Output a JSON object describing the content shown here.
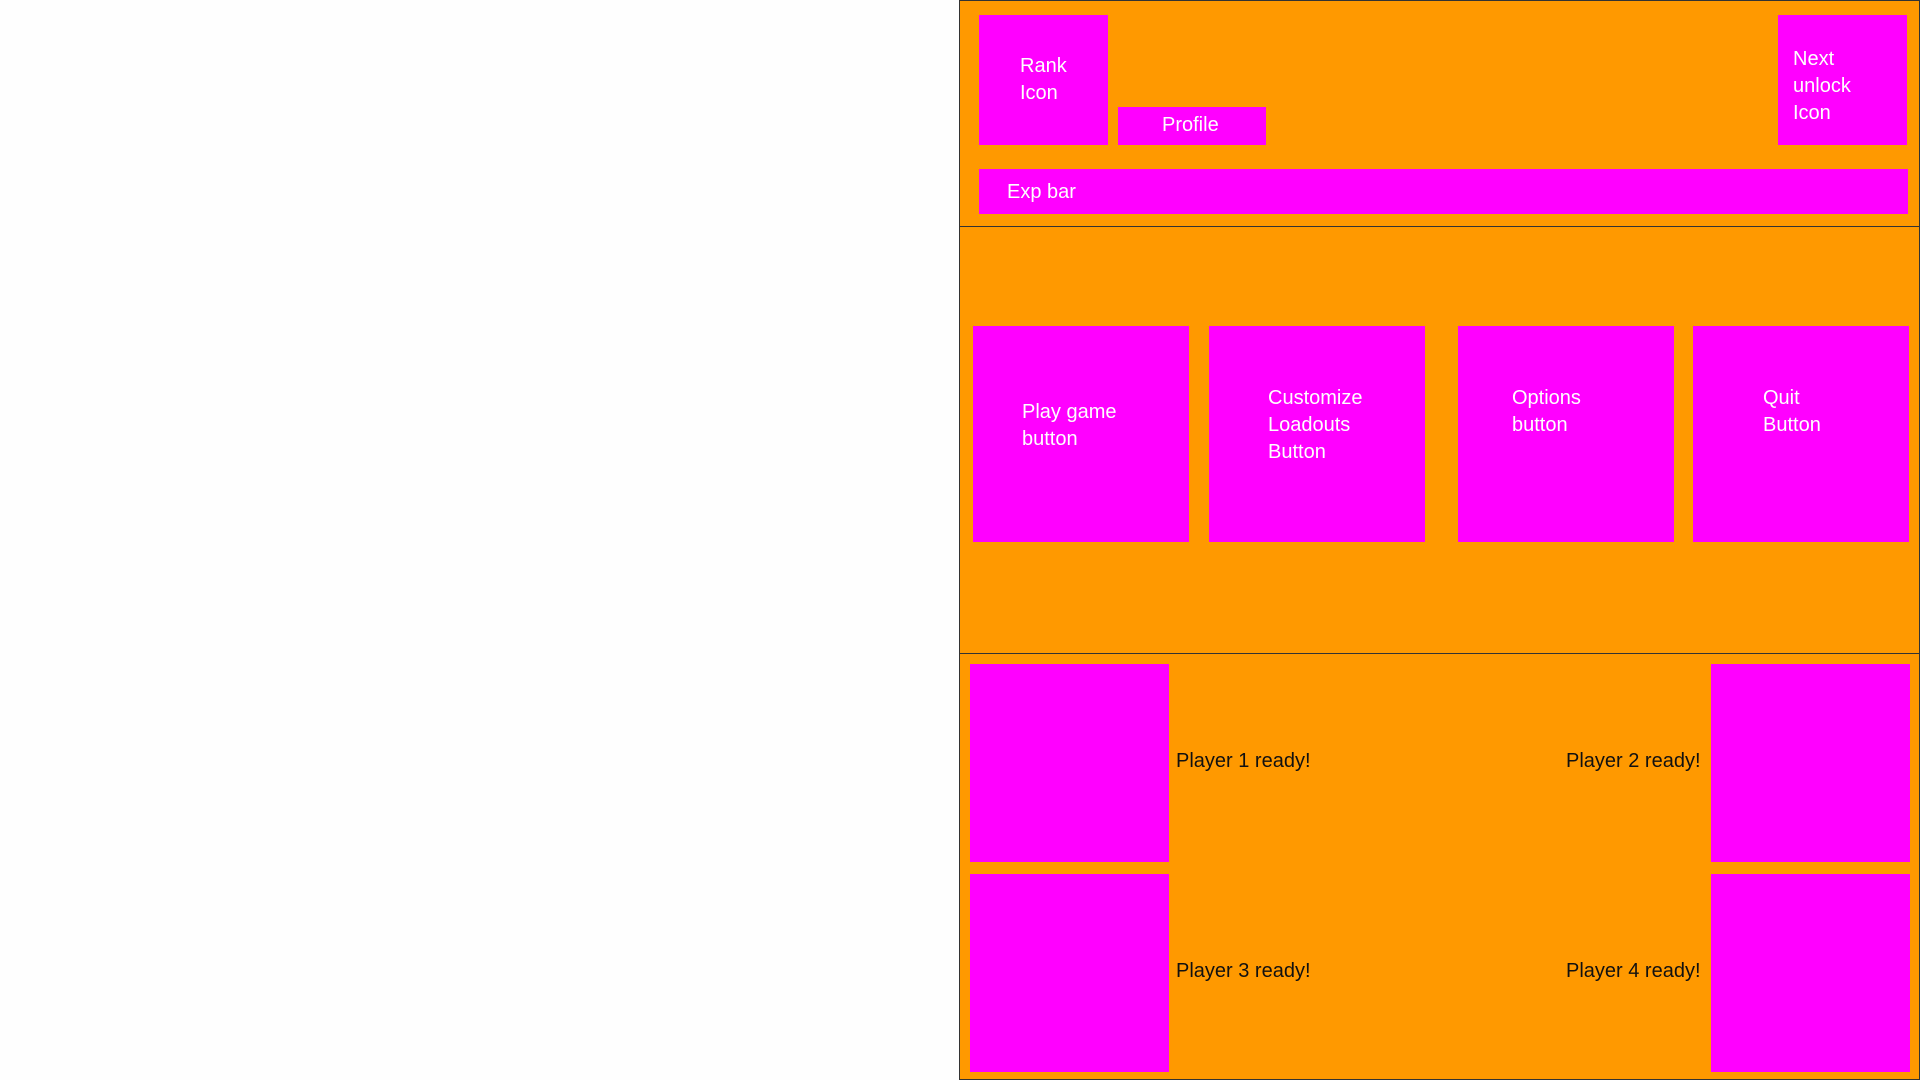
{
  "header": {
    "rank_icon_label": "Rank\nIcon",
    "profile_label": "Profile",
    "next_unlock_label": "Next\nunlock\nIcon",
    "exp_bar_label": "Exp bar"
  },
  "menu": {
    "play_label": "Play game\nbutton",
    "customize_label": "Customize\nLoadouts\nButton",
    "options_label": "Options\nbutton",
    "quit_label": "Quit\nButton"
  },
  "players": {
    "p1": "Player 1 ready!",
    "p2": "Player 2 ready!",
    "p3": "Player 3 ready!",
    "p4": "Player 4 ready!"
  },
  "colors": {
    "background": "#ff9900",
    "placeholder": "#ff00ff",
    "page": "#ffffff"
  }
}
